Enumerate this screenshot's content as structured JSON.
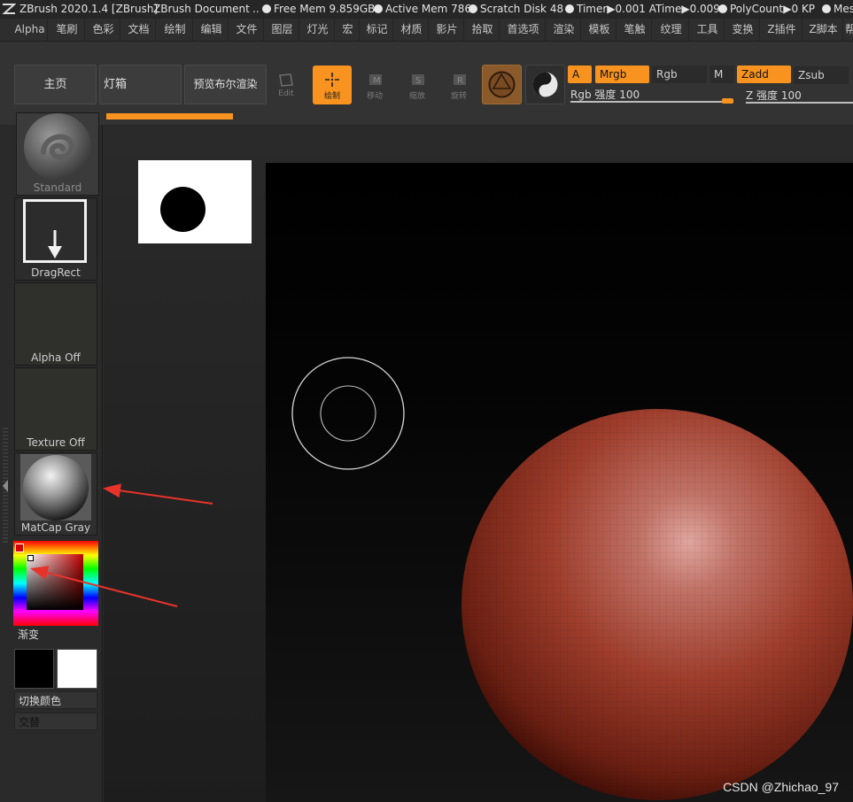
{
  "titlebar": {
    "app_title": "ZBrush 2020.1.4 [ZBrush]",
    "document": "ZBrush Document",
    "free_mem": "Free Mem 9.859GB",
    "active_mem": "Active Mem 786",
    "scratch_disk": "Scratch Disk 48",
    "timer": "Timer▶0.001 ATime▶0.009",
    "polycount": "PolyCount▶0 KP",
    "mesh": "Mes",
    "dots_separator": ".."
  },
  "menubar": {
    "items": [
      "Alpha",
      "笔刷",
      "色彩",
      "文档",
      "绘制",
      "编辑",
      "文件",
      "图层",
      "灯光",
      "宏",
      "标记",
      "材质",
      "影片",
      "拾取",
      "首选项",
      "渲染",
      "模板",
      "笔触",
      "纹理",
      "工具",
      "变换",
      "Z插件",
      "Z脚本",
      "帮"
    ]
  },
  "shelf": {
    "home": "主页",
    "lightbox": "灯箱",
    "preview_render": "预览布尔渲染",
    "edit": "Edit",
    "draw": "绘制",
    "move": "移动",
    "scale": "缩放",
    "rotate": "旋转",
    "move_letter": "M",
    "scale_letter": "S",
    "rotate_letter": "R",
    "a_btn": "A",
    "mrgb": "Mrgb",
    "rgb": "Rgb",
    "m": "M",
    "zadd": "Zadd",
    "zsub": "Zsub",
    "rgb_intensity": "Rgb 强度 100",
    "z_intensity": "Z 强度 100",
    "colors": {
      "accent": "#f7931e",
      "active_bg": "#f7931e"
    }
  },
  "left": {
    "brush": "Standard",
    "stroke": "DragRect",
    "alpha": "Alpha Off",
    "texture": "Texture Off",
    "material": "MatCap Gray",
    "gradient": "渐变",
    "switch_color": "切换颜色",
    "alternate": "交替",
    "colors": {
      "main": "#000000",
      "secondary": "#ffffff"
    }
  },
  "canvas": {
    "watermark": "CSDN @Zhichao_97",
    "sphere_color": "#a83e2e"
  }
}
